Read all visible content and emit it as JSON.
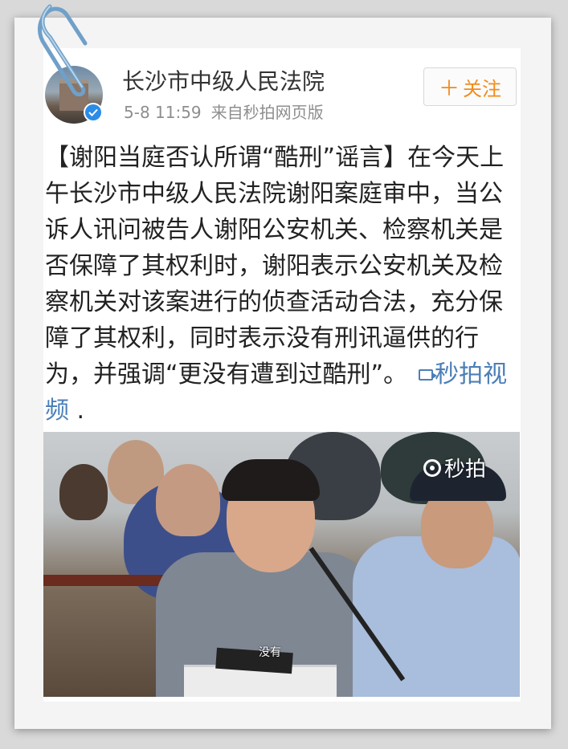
{
  "post": {
    "account_name": "长沙市中级人民法院",
    "timestamp": "5-8 11:59",
    "source": "来自秒拍网页版",
    "follow_label": "关注",
    "text_main": "【谢阳当庭否认所谓“酷刑”谣言】在今天上午长沙市中级人民法院谢阳案庭审中，当公诉人讯问被告人谢阳公安机关、检察机关是否保障了其权利时，谢阳表示公安机关及检察机关对该案进行的侦查活动合法，充分保障了其权利，同时表示没有刑讯逼供的行为，并强调“更没有遭到过酷刑”。",
    "video_link_label": "秒拍视频",
    "trailing": " ."
  },
  "video": {
    "watermark": "秒拍",
    "subtitle": "没有"
  },
  "icons": {
    "paperclip": "paperclip-icon",
    "verified": "verified-badge-icon",
    "video": "video-icon",
    "follow_plus": "plus-icon"
  },
  "colors": {
    "follow_accent": "#f28b1a",
    "link": "#4b7fb8",
    "verified": "#2a8ce8"
  }
}
